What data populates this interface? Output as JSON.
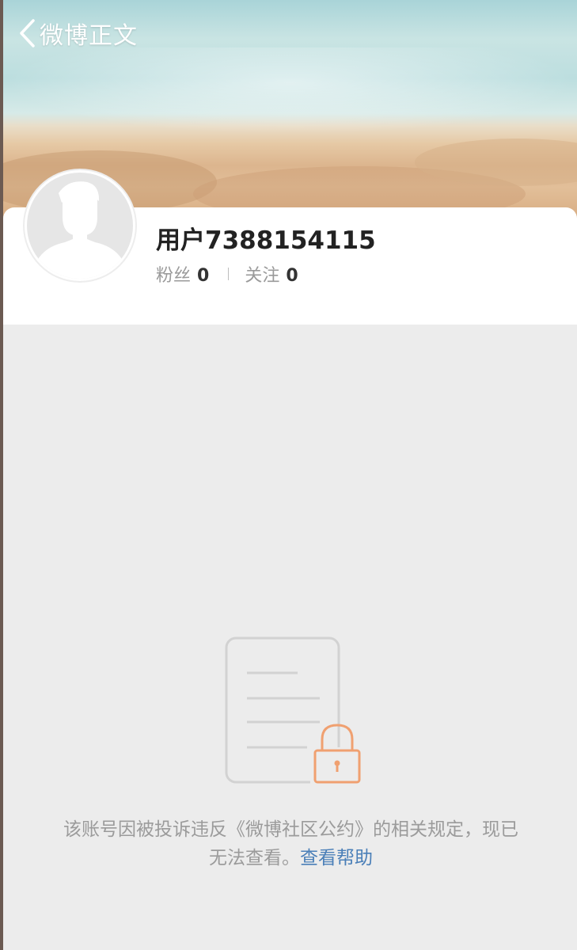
{
  "nav": {
    "back_label": "微博正文"
  },
  "profile": {
    "username": "用户7388154115",
    "followers_label": "粉丝",
    "followers_count": "0",
    "following_label": "关注",
    "following_count": "0"
  },
  "blocked": {
    "message": "该账号因被投诉违反《微博社区公约》的相关规定，现已无法查看。",
    "help_link": "查看帮助"
  },
  "icons": {
    "back": "chevron-left-icon",
    "avatar": "default-avatar-icon",
    "document": "document-icon",
    "lock": "lock-icon"
  },
  "colors": {
    "link": "#4a7fb8",
    "lock": "#f0a070",
    "muted_text": "#9b9b9b",
    "background": "#ececec"
  }
}
